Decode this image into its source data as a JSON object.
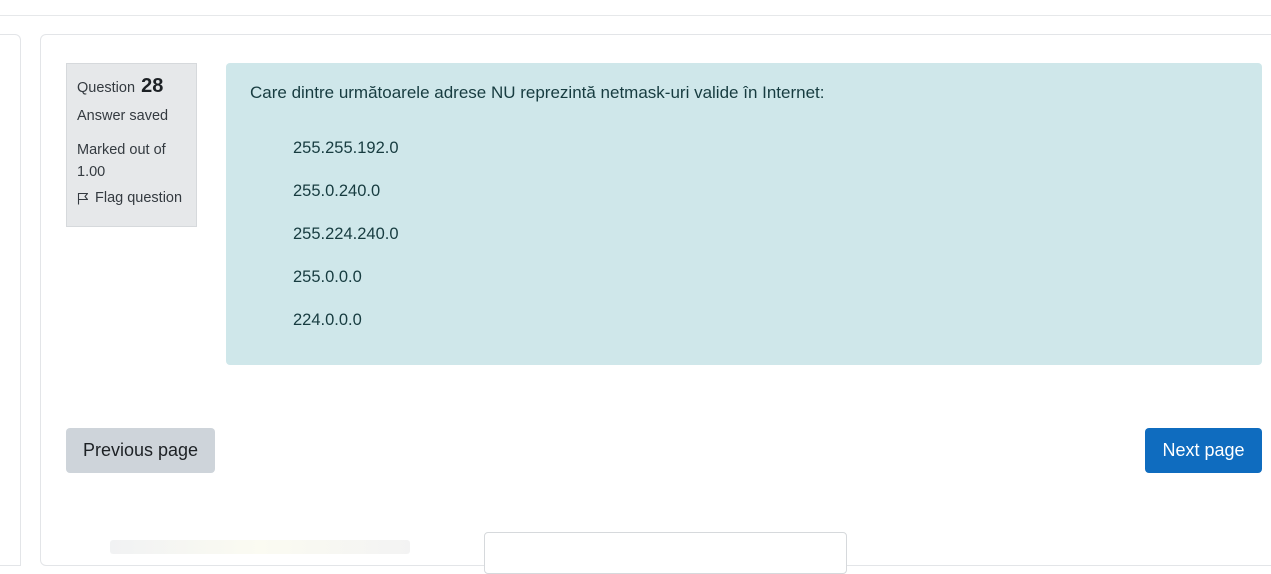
{
  "question": {
    "label": "Question",
    "number": "28",
    "state": "Answer saved",
    "grade": "Marked out of 1.00",
    "flag_label": "Flag question",
    "text": "Care dintre următoarele adrese NU reprezintă netmask-uri valide în Internet:",
    "answers": [
      "255.255.192.0",
      "255.0.240.0",
      "255.224.240.0",
      "255.0.0.0",
      "224.0.0.0"
    ]
  },
  "navigation": {
    "previous_label": "Previous page",
    "next_label": "Next page"
  },
  "colors": {
    "info_bg": "#e6e8ea",
    "content_bg": "#cfe7ea",
    "next_button": "#0f6cbf",
    "prev_button": "#ced4da"
  }
}
